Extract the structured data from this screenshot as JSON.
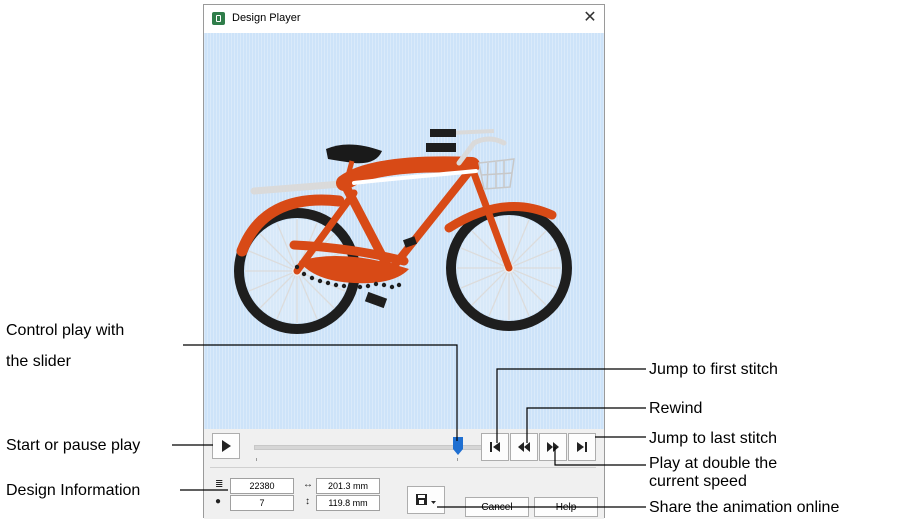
{
  "window": {
    "title": "Design Player",
    "close_glyph": "✕",
    "icon": "design-player-app-icon"
  },
  "player": {
    "slider_position": 0.85,
    "stitch_count": "22380",
    "color_count": "7",
    "width": "201.3 mm",
    "height": "119.8 mm",
    "cancel_label": "Cancel",
    "help_label": "Help"
  },
  "annotations": {
    "slider_line1": "Control play with",
    "slider_line2": "the slider",
    "start_pause": "Start or pause play",
    "design_info": "Design Information",
    "first_stitch": "Jump to first stitch",
    "rewind": "Rewind",
    "last_stitch": "Jump to last stitch",
    "double_line1": "Play at double the",
    "double_line2": "current speed",
    "share": "Share the animation online"
  },
  "colors": {
    "canvas": "#cde3f9",
    "bike_frame": "#d84a16",
    "tires": "#1e1e1e",
    "spokes": "#dcdcdc",
    "slider_thumb": "#1f6fd1"
  }
}
